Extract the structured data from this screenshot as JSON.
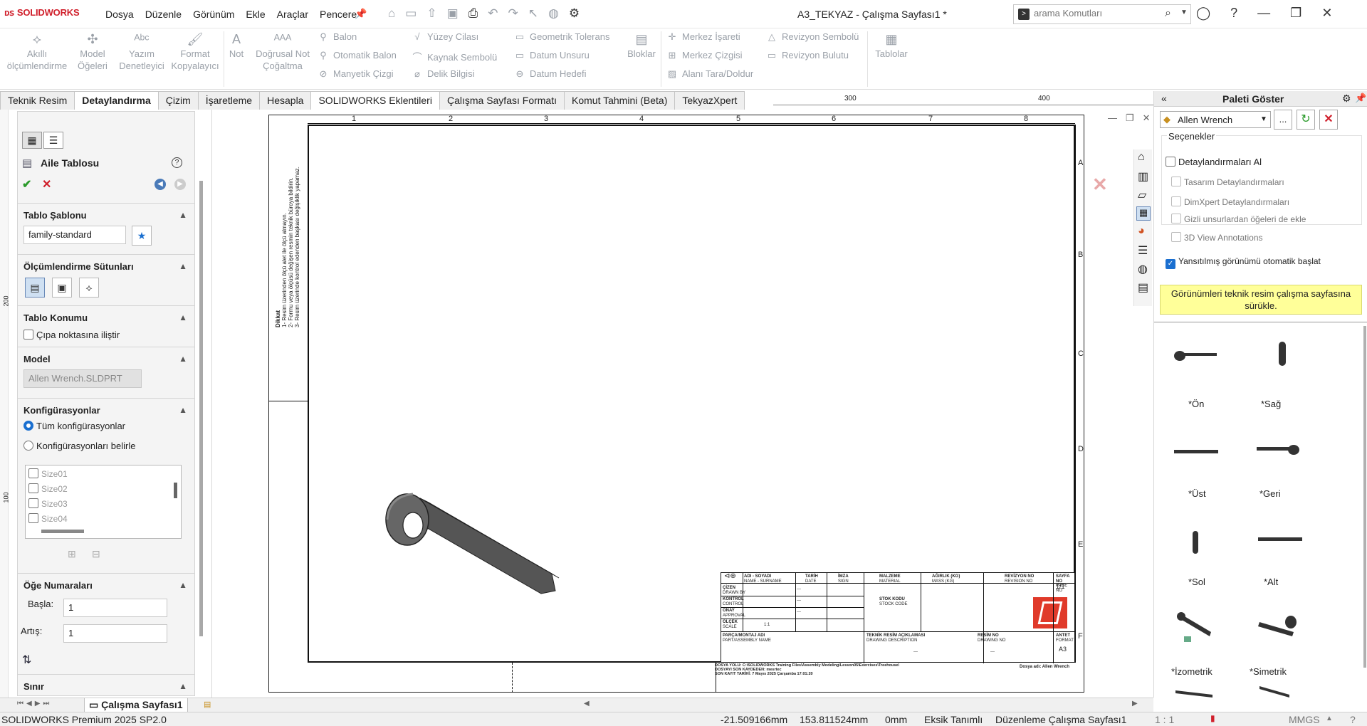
{
  "titlebar": {
    "logo": "SOLIDWORKS",
    "menus": [
      "Dosya",
      "Düzenle",
      "Görünüm",
      "Ekle",
      "Araçlar",
      "Pencere"
    ],
    "doc_title": "A3_TEKYAZ - Çalışma Sayfası1 *",
    "search_placeholder": "arama Komutları"
  },
  "ribbon": {
    "big": [
      {
        "label": "Akıllı\nölçümlendirme",
        "icon": "smart-dimension-icon"
      },
      {
        "label": "Model\nÖğeleri",
        "icon": "model-items-icon"
      },
      {
        "label": "Yazım\nDenetleyici",
        "icon": "spell-checker-icon"
      },
      {
        "label": "Format\nKopyalayıcı",
        "icon": "format-painter-icon"
      },
      {
        "label": "Not",
        "icon": "note-icon"
      },
      {
        "label": "Doğrusal Not\nÇoğaltma",
        "icon": "linear-note-pattern-icon"
      }
    ],
    "col1": [
      "Balon",
      "Otomatik Balon",
      "Manyetik Çizgi"
    ],
    "col2": [
      "Yüzey Cilası",
      "Kaynak Sembolü",
      "Delik Bilgisi"
    ],
    "col3": [
      "Geometrik Tolerans",
      "Datum Unsuru",
      "Datum Hedefi"
    ],
    "blocks": "Bloklar",
    "col4": [
      "Merkez İşareti",
      "Merkez Çizgisi",
      "Alanı Tara/Doldur"
    ],
    "col5": [
      "Revizyon Sembolü",
      "Revizyon Bulutu"
    ],
    "tables": "Tablolar"
  },
  "tabs": [
    "Teknik Resim",
    "Detaylandırma",
    "Çizim",
    "İşaretleme",
    "Hesapla",
    "SOLIDWORKS Eklentileri",
    "Çalışma Sayfası Formatı",
    "Komut Tahmini (Beta)",
    "TekyazXpert"
  ],
  "ruler_top": [
    "300",
    "400"
  ],
  "ruler_left": [
    "200",
    "100"
  ],
  "pm": {
    "title": "Aile Tablosu",
    "sec_template": "Tablo Şablonu",
    "template_value": "family-standard",
    "sec_dim_cols": "Ölçümlendirme Sütunları",
    "sec_position": "Tablo Konumu",
    "anchor_label": "Çıpa noktasına iliştir",
    "sec_model": "Model",
    "model_value": "Allen Wrench.SLDPRT",
    "sec_configs": "Konfigürasyonlar",
    "radio_all": "Tüm konfigürasyonlar",
    "radio_specify": "Konfigürasyonları belirle",
    "configs": [
      "Size01",
      "Size02",
      "Size03",
      "Size04"
    ],
    "sec_item_numbers": "Öğe Numaraları",
    "start_label": "Başla:",
    "start_value": "1",
    "increment_label": "Artış:",
    "increment_value": "1",
    "sec_border": "Sınır"
  },
  "sheet": {
    "zone_numbers": [
      "1",
      "2",
      "3",
      "4",
      "5",
      "6",
      "7",
      "8"
    ],
    "zone_letters": [
      "A",
      "B",
      "C",
      "D",
      "E",
      "F"
    ],
    "notes": [
      "Dikkat",
      "1- Resim üzerinden ölçü alet ile ölçü almayın.",
      "2- Formu veya ölçüsü değişen resmin teknik büroya bildirin.",
      "3- Resim üzerinde kontrol edenden başkası değişiklik yapamaz."
    ]
  },
  "titleblock": {
    "h_name": "ADI - SOYADI",
    "h_name_en": "NAME - SURNAME",
    "h_date": "TARİH",
    "h_date_en": "DATE",
    "h_sign": "İMZA",
    "h_sign_en": "SIGN",
    "h_material": "MALZEME",
    "h_material_en": "MATERIAL",
    "h_weight": "AĞIRLIK (KG)",
    "h_weight_en": "MASS (KG)",
    "h_rev": "REVİZYON NO",
    "h_rev_en": "REVISION NO",
    "h_page": "SAYFA NO",
    "h_page_en": "PAGE NO",
    "page_value": "1/1",
    "r_drawn": "ÇİZEN",
    "r_drawn_en": "DRAWN BY",
    "r_control": "KONTROL",
    "r_control_en": "CONTROL",
    "r_approval": "ONAY",
    "r_approval_en": "APPROVAL",
    "r_scale": "ÖLÇEK",
    "r_scale_en": "SCALE",
    "scale_value": "1:1",
    "dash": "---",
    "stock_code": "STOK KODU",
    "stock_code_en": "STOCK CODE",
    "part_name": "PARÇA/MONTAJ ADI",
    "part_name_en": "PART/ASSEMBLY NAME",
    "desc": "TEKNİK RESİM AÇIKLAMASI",
    "desc_en": "DRAWING DESCRIPTION",
    "drawing_no": "RESİM NO",
    "drawing_no_en": "DRAWING NO",
    "format": "ANTET",
    "format_en": "FORMAT",
    "format_value": "A3",
    "file_path": "DOSYA YOLU: C:\\SOLIDWORKS Training Files\\Assembly Modeling\\Lesson05\\Exercises\\Treehouse\\",
    "saved_by": "DOSYAYI SON KAYDEDEN: mesrtec",
    "last_save": "SON KAYIT TARİHİ: 7 Mayıs 2025 Çarşamba 17:01:20",
    "file_name": "Dosya adı: Allen Wrench"
  },
  "palette": {
    "title": "Paleti Göster",
    "model_select": "Allen Wrench",
    "browse": "...",
    "options_title": "Seçenekler",
    "opt_import": "Detaylandırmaları Al",
    "opt_design": "Tasarım Detaylandırmaları",
    "opt_dimxpert": "DimXpert Detaylandırmaları",
    "opt_hidden": "Gizli unsurlardan öğeleri de ekle",
    "opt_3d": "3D View Annotations",
    "opt_auto": "Yansıtılmış görünümü otomatik başlat",
    "hint": "Görünümleri teknik resim çalışma sayfasına sürükle.",
    "views": [
      "*Ön",
      "*Sağ",
      "*Üst",
      "*Geri",
      "*Sol",
      "*Alt",
      "*İzometrik",
      "*Simetrik"
    ]
  },
  "sheetbar": {
    "sheet_tab": "Çalışma Sayfası1"
  },
  "status": {
    "product": "SOLIDWORKS Premium 2025 SP2.0",
    "x": "-21.509166mm",
    "y": "153.811524mm",
    "z": "0mm",
    "defined": "Eksik Tanımlı",
    "mode": "Düzenleme Çalışma Sayfası1",
    "scale": "1 : 1",
    "units": "MMGS"
  },
  "colors": {
    "accent": "#1a6fd0",
    "brand": "#d0202c",
    "hint_bg": "#ffff99",
    "ok": "#2a9a2a",
    "cancel": "#d0202c"
  }
}
